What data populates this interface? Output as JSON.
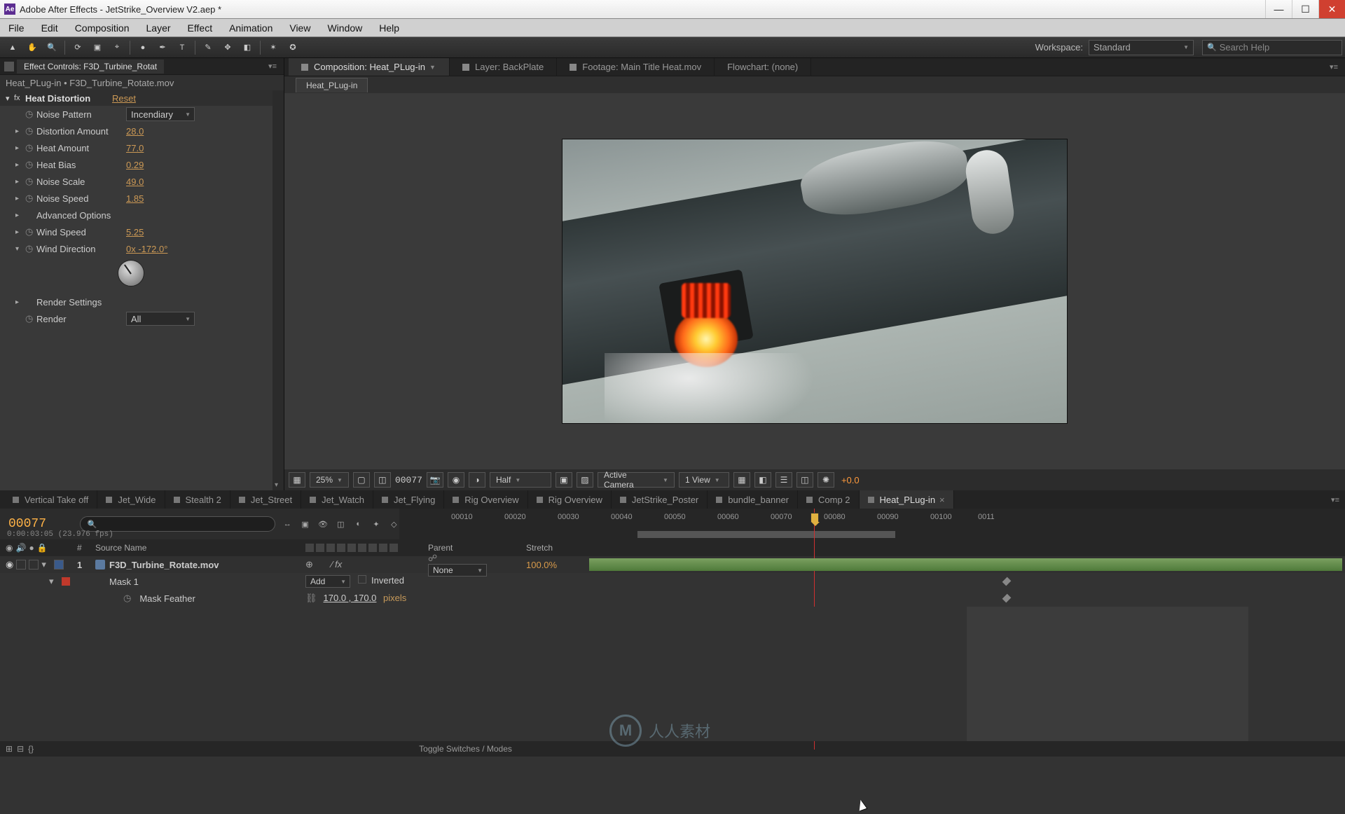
{
  "window": {
    "app_badge": "Ae",
    "title": "Adobe After Effects - JetStrike_Overview V2.aep *"
  },
  "menu": [
    "File",
    "Edit",
    "Composition",
    "Layer",
    "Effect",
    "Animation",
    "View",
    "Window",
    "Help"
  ],
  "workspace": {
    "label": "Workspace:",
    "value": "Standard"
  },
  "search_help_placeholder": "Search Help",
  "effect_controls_tab": "Effect Controls: F3D_Turbine_Rotat",
  "breadcrumb": "Heat_PLug-in • F3D_Turbine_Rotate.mov",
  "fx": {
    "name": "Heat Distortion",
    "reset": "Reset",
    "params": [
      {
        "name": "Noise Pattern",
        "type": "drop",
        "value": "Incendiary"
      },
      {
        "name": "Distortion Amount",
        "type": "num",
        "value": "28.0"
      },
      {
        "name": "Heat Amount",
        "type": "num",
        "value": "77.0"
      },
      {
        "name": "Heat Bias",
        "type": "num",
        "value": "0.29"
      },
      {
        "name": "Noise Scale",
        "type": "num",
        "value": "49.0"
      },
      {
        "name": "Noise Speed",
        "type": "num",
        "value": "1.85"
      },
      {
        "name": "Advanced Options",
        "type": "group"
      },
      {
        "name": "Wind Speed",
        "type": "num",
        "value": "5.25"
      },
      {
        "name": "Wind Direction",
        "type": "angle",
        "value": "0x -172.0°"
      },
      {
        "name": "Render Settings",
        "type": "group"
      },
      {
        "name": "Render",
        "type": "drop",
        "value": "All"
      }
    ]
  },
  "viewer_tabs": [
    {
      "label": "Composition: Heat_PLug-in",
      "active": true,
      "drop": true
    },
    {
      "label": "Layer: BackPlate"
    },
    {
      "label": "Footage: Main Title Heat.mov"
    },
    {
      "label": "Flowchart: (none)"
    }
  ],
  "viewer_subtab": "Heat_PLug-in",
  "viewer_footer": {
    "zoom": "25%",
    "timecode": "00077",
    "resolution": "Half",
    "camera": "Active Camera",
    "views": "1 View",
    "exposure": "+0.0"
  },
  "timeline_tabs": [
    "Vertical Take off",
    "Jet_Wide",
    "Stealth 2",
    "Jet_Street",
    "Jet_Watch",
    "Jet_Flying",
    "Rig Overview",
    "Rig Overview",
    "JetStrike_Poster",
    "bundle_banner",
    "Comp 2",
    "Heat_PLug-in"
  ],
  "timeline_active_tab": 11,
  "timeline": {
    "current_frame": "00077",
    "time_small": "0:00:03:05 (23.976 fps)",
    "ticks": [
      "00010",
      "00020",
      "00030",
      "00040",
      "00050",
      "00060",
      "00070",
      "00080",
      "00090",
      "00100",
      "0011"
    ],
    "col_source": "Source Name",
    "col_parent": "Parent",
    "col_stretch": "Stretch"
  },
  "layers": [
    {
      "num": "1",
      "name": "F3D_Turbine_Rotate.mov",
      "parent": "None",
      "stretch": "100.0%"
    }
  ],
  "mask": {
    "label": "Mask 1",
    "mode": "Add",
    "inverted_label": "Inverted",
    "feather_label": "Mask Feather",
    "feather_value": "170.0 , 170.0",
    "feather_units": "pixels"
  },
  "footer_toggle": "Toggle Switches / Modes",
  "watermark_text": "人人素材"
}
